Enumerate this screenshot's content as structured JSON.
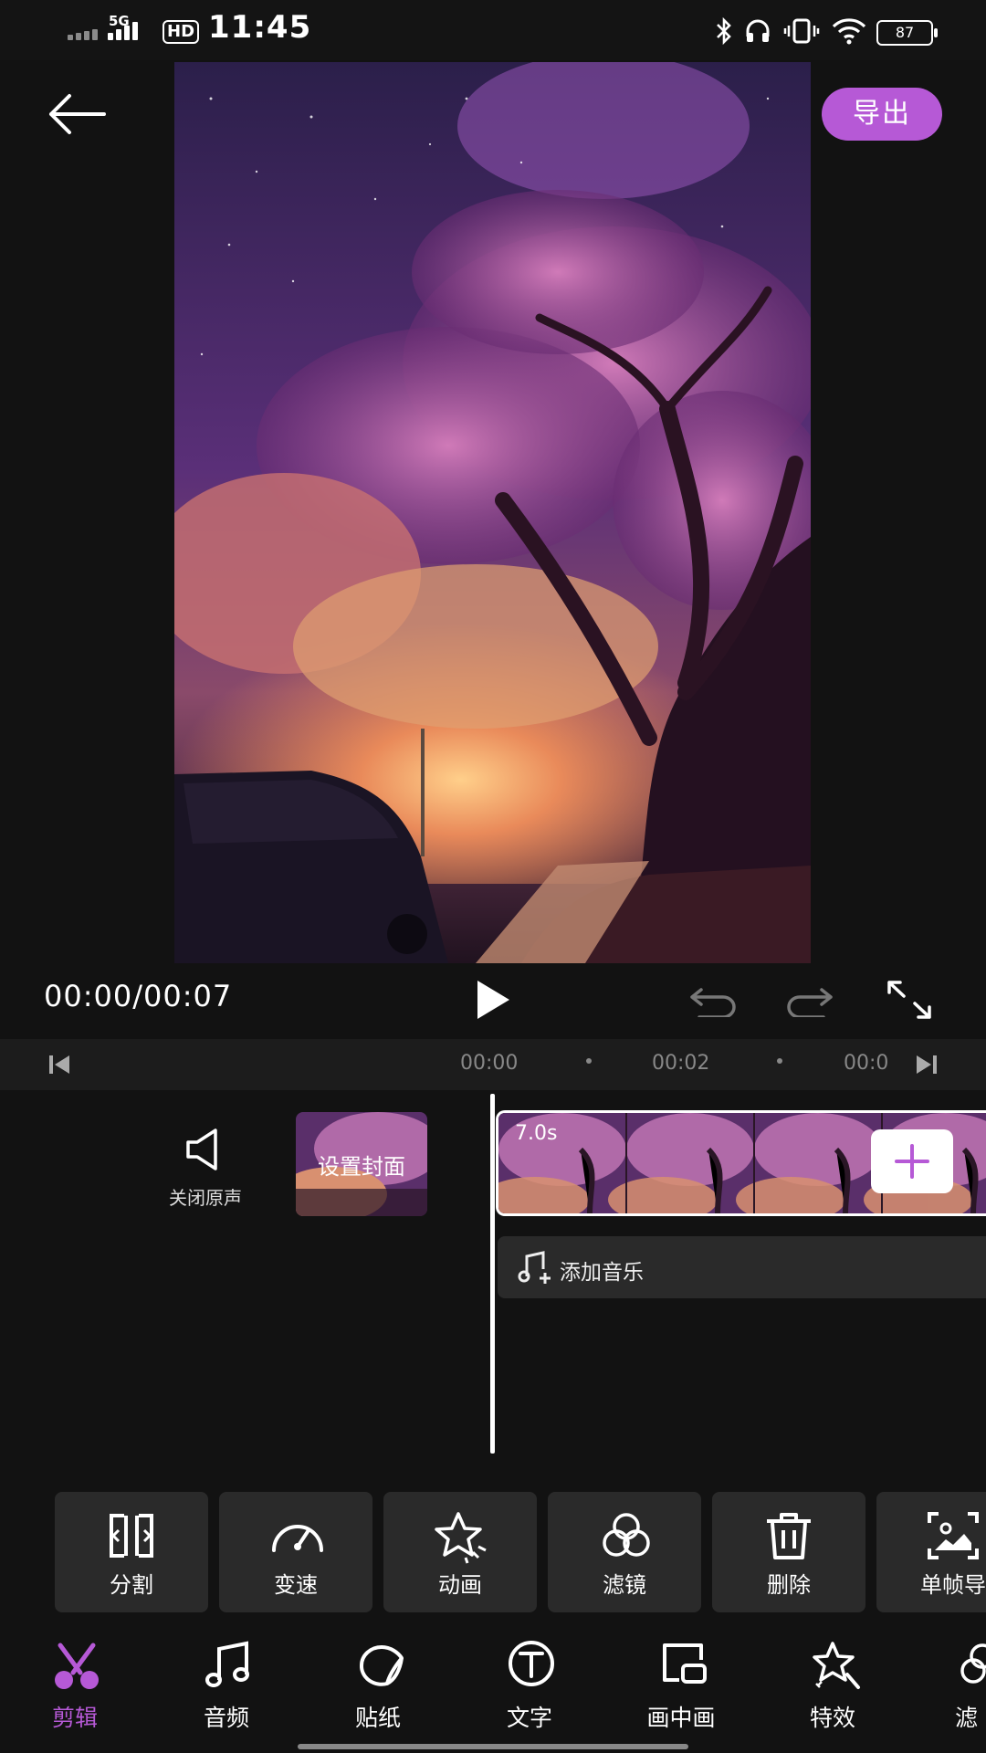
{
  "status_bar": {
    "time": "11:45",
    "network": "5G",
    "hd": "HD",
    "battery": "87",
    "icons": [
      "signal-icon",
      "bluetooth-icon",
      "headphones-icon",
      "vibrate-icon",
      "wifi-icon",
      "battery-icon"
    ]
  },
  "header": {
    "back_icon": "arrow-left-icon",
    "export_label": "导出"
  },
  "player": {
    "time": "00:00/00:07",
    "icons": [
      "play-icon",
      "undo-icon",
      "redo-icon",
      "fullscreen-icon"
    ]
  },
  "ruler": {
    "ticks": [
      "00:00",
      "00:02",
      "00:0"
    ]
  },
  "timeline": {
    "mute_label": "关闭原声",
    "cover_label": "设置封面",
    "clip_duration": "7.0s",
    "add_music_label": "添加音乐"
  },
  "tools": [
    {
      "label": "分割",
      "icon": "split-icon"
    },
    {
      "label": "变速",
      "icon": "speed-icon"
    },
    {
      "label": "动画",
      "icon": "animation-icon"
    },
    {
      "label": "滤镜",
      "icon": "filter-icon"
    },
    {
      "label": "删除",
      "icon": "delete-icon"
    },
    {
      "label": "单帧导",
      "icon": "frame-export-icon"
    }
  ],
  "bottom_nav": [
    {
      "label": "剪辑",
      "icon": "scissors-icon",
      "active": true
    },
    {
      "label": "音频",
      "icon": "music-icon"
    },
    {
      "label": "贴纸",
      "icon": "sticker-icon"
    },
    {
      "label": "文字",
      "icon": "text-icon"
    },
    {
      "label": "画中画",
      "icon": "pip-icon"
    },
    {
      "label": "特效",
      "icon": "effects-icon"
    },
    {
      "label": "滤",
      "icon": "filter-icon"
    }
  ],
  "colors": {
    "accent": "#b659d6",
    "background": "#121212",
    "panel": "#2a2a2a"
  }
}
